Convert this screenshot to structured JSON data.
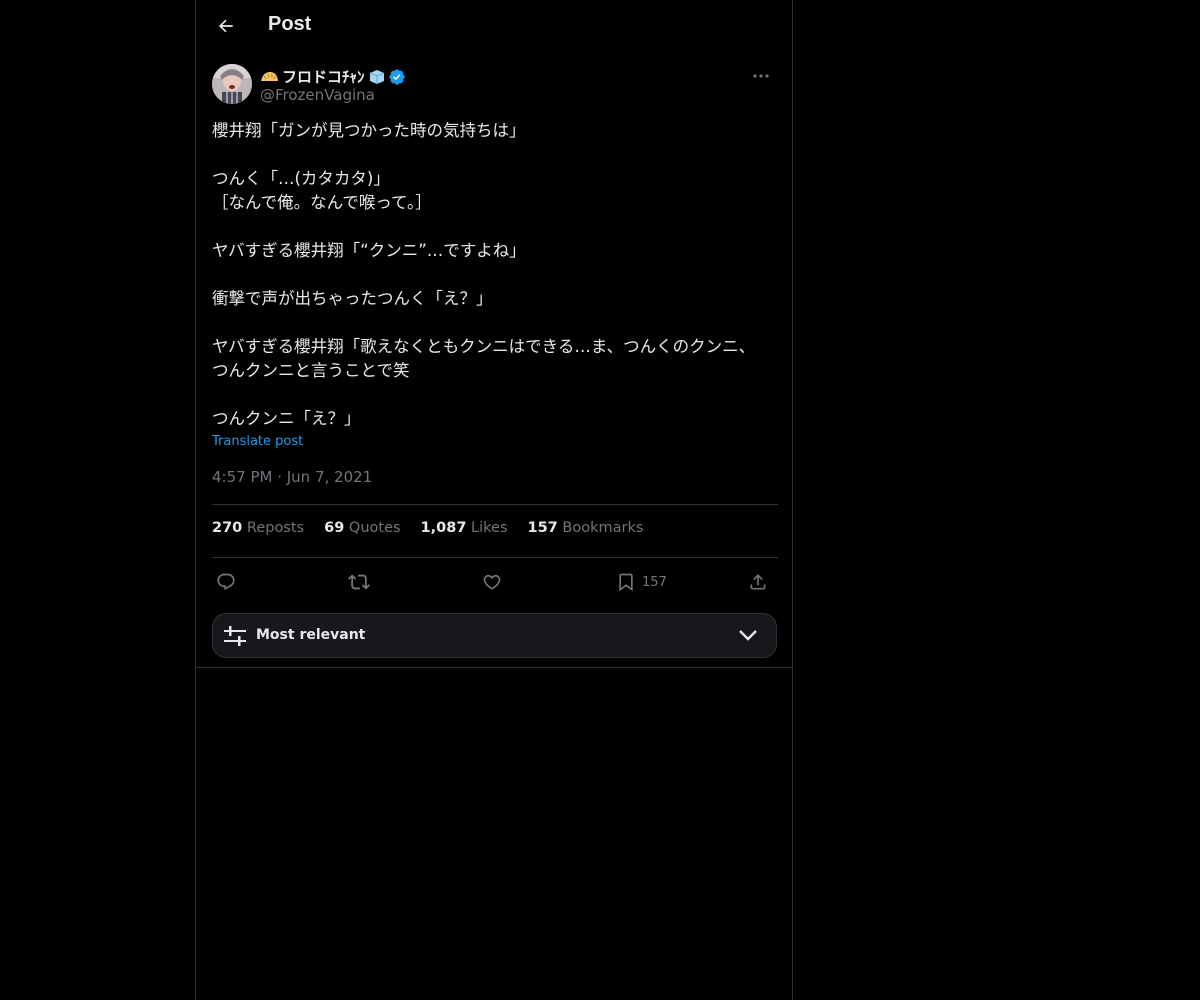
{
  "header": {
    "title": "Post"
  },
  "post": {
    "display_name": "フロドコﾁｬﾝ",
    "handle": "@FrozenVagina",
    "text": "櫻井翔「ガンが見つかった時の気持ちは」\n\nつんく「…(カタカタ)」\n［なんで俺。なんで喉って。］\n\nヤバすぎる櫻井翔「“クンニ”…ですよね」\n\n衝撃で声が出ちゃったつんく「え？」\n\nヤバすぎる櫻井翔「歌えなくともクンニはできる…ま、つんくのクンニ、\nつんクンニと言うことで笑\n\nつんクンニ「え？」",
    "translate_label": "Translate post",
    "timestamp": "4:57 PM · Jun 7, 2021"
  },
  "stats": [
    {
      "count": "270",
      "label": "Reposts"
    },
    {
      "count": "69",
      "label": "Quotes"
    },
    {
      "count": "1,087",
      "label": "Likes"
    },
    {
      "count": "157",
      "label": "Bookmarks"
    }
  ],
  "actions": {
    "bookmark_count": "157"
  },
  "sort": {
    "label": "Most relevant"
  },
  "colors": {
    "accent": "#1d9bf0",
    "verified": "#1d9bf0",
    "text": "#e7e9ea",
    "muted": "#71767b",
    "border": "#2f3336"
  },
  "icons": [
    "back-arrow-icon",
    "verified-badge-icon",
    "more-icon",
    "reply-icon",
    "repost-icon",
    "like-icon",
    "bookmark-icon",
    "share-icon",
    "sliders-icon",
    "chevron-down-icon"
  ]
}
